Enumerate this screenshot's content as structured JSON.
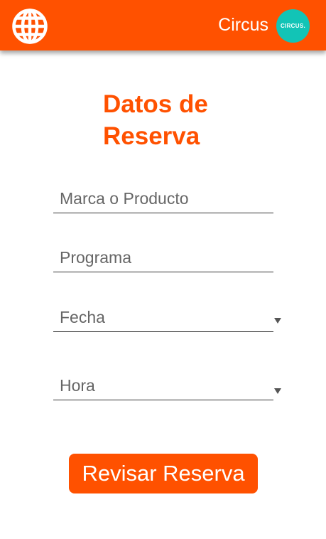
{
  "header": {
    "brand_name": "Circus",
    "avatar_text": "CIRCUS.",
    "globe_icon": "globe-icon"
  },
  "form": {
    "title_line1": "Datos de",
    "title_line2": "Reserva",
    "fields": [
      {
        "label": "Marca o Producto"
      },
      {
        "label": "Programa"
      },
      {
        "label": "Fecha"
      },
      {
        "label": "Hora"
      }
    ],
    "submit_label": "Revisar Reserva"
  },
  "colors": {
    "accent": "#ff5100",
    "avatar_bg": "#12c4b6"
  }
}
